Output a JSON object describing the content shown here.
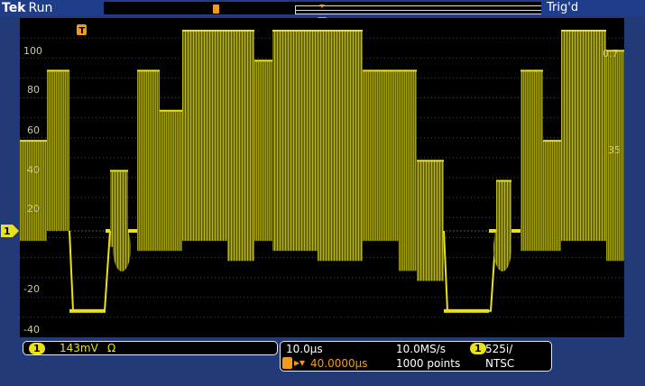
{
  "header": {
    "brand": "Tek",
    "run_state": "Run",
    "trigger_status": "Trig'd"
  },
  "graticule": {
    "left_labels": [
      "100",
      "80",
      "60",
      "40",
      "20",
      "-20",
      "-40"
    ],
    "right_labels": [
      "0.7",
      "35"
    ],
    "channel_marker": "1",
    "trigger_marker": "T"
  },
  "channel_readout": {
    "channel": "1",
    "scale": "143mV",
    "coupling_symbol": "Ω"
  },
  "timebase_readout": {
    "time_per_div": "10.0μs",
    "sample_rate": "10.0MS/s",
    "trigger_position": "40.0000μs",
    "record_length": "1000 points",
    "trigger_channel": "1",
    "video_standard_line1": "525i/",
    "video_standard_line2": "NTSC"
  },
  "colors": {
    "trace": "#e9e21a",
    "trigger": "#f39a1e",
    "background": "#000000",
    "frame": "#223a78"
  }
}
